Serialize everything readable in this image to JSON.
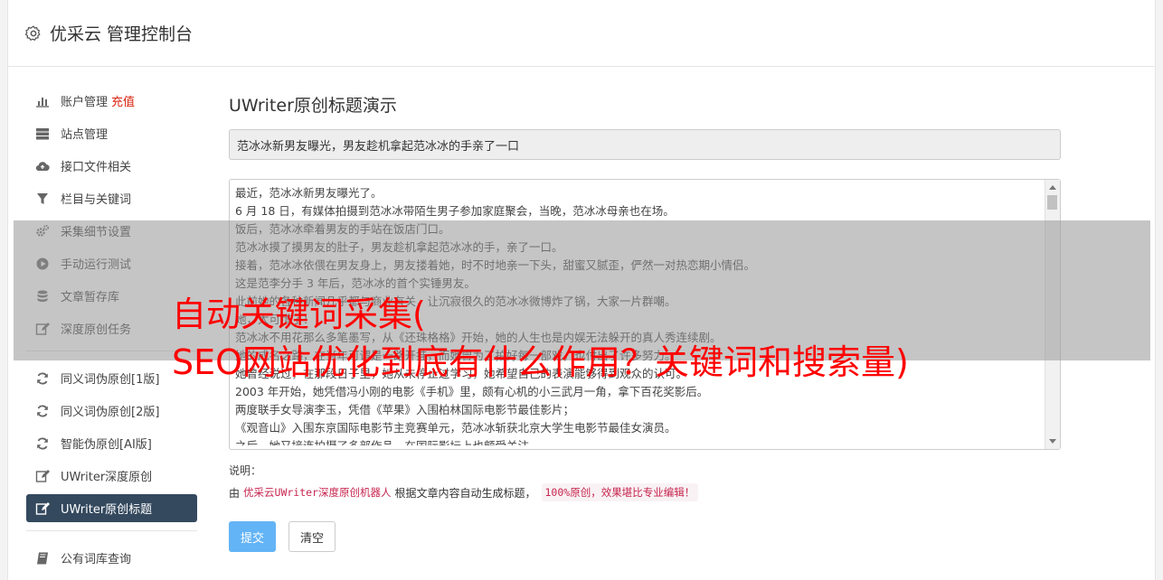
{
  "header": {
    "title": "优采云 管理控制台",
    "icon": "gear-icon"
  },
  "sidebar": {
    "groups": [
      [
        {
          "label": "账户管理",
          "badge": "充值",
          "icon": "bar-chart-icon",
          "active": false
        },
        {
          "label": "站点管理",
          "icon": "server-icon",
          "active": false
        },
        {
          "label": "接口文件相关",
          "icon": "cloud-upload-icon",
          "active": false
        },
        {
          "label": "栏目与关键词",
          "icon": "filter-icon",
          "active": false
        },
        {
          "label": "采集细节设置",
          "icon": "cogs-icon",
          "active": false
        },
        {
          "label": "手动运行测试",
          "icon": "play-circle-icon",
          "active": false
        },
        {
          "label": "文章暂存库",
          "icon": "database-icon",
          "active": false
        },
        {
          "label": "深度原创任务",
          "icon": "edit-icon",
          "active": false
        }
      ],
      [
        {
          "label": "同义词伪原创[1版]",
          "icon": "refresh-icon",
          "active": false
        },
        {
          "label": "同义词伪原创[2版]",
          "icon": "refresh-icon",
          "active": false
        },
        {
          "label": "智能伪原创[AI版]",
          "icon": "refresh-icon",
          "active": false
        },
        {
          "label": "UWriter深度原创",
          "icon": "edit-icon",
          "active": false
        },
        {
          "label": "UWriter原创标题",
          "icon": "edit-icon",
          "active": true
        }
      ],
      [
        {
          "label": "公有词库查询",
          "icon": "book-icon",
          "active": false
        }
      ]
    ]
  },
  "main": {
    "heading": "UWriter原创标题演示",
    "title_value": "范冰冰新男友曝光，男友趁机拿起范冰冰的手亲了一口",
    "content_lines": [
      "最近，范冰冰新男友曝光了。",
      "6 月 18 日，有媒体拍摄到范冰冰带陌生男子参加家庭聚会，当晚，范冰冰母亲也在场。",
      "饭后，范冰冰牵着男友的手站在饭店门口。",
      "范冰冰摸了摸男友的肚子，男友趁机拿起范冰冰的手，亲了一口。",
      "接着，范冰冰依偎在男友身上，男友搂着她，时不时地亲一下头，甜蜜又腻歪，俨然一对热恋期小情侣。",
      "这是范李分手 3 年后，范冰冰的首个实锤男友。",
      "此前她的各种新闻几乎都与商业有关，让沉寂很久的范冰冰微博炸了锅，大家一片群嘲。",
      "她，太可惜了！",
      "范冰冰不用花那么多笔墨写，从《还珠格格》开始，她的人生也是内娱无法躲开的真人秀连续剧。",
      "她的成名之路，在当年可谓是一路开挂，而她曾为了拍好每一部戏，也付出了许多努力。",
      "她曾经说过，在那段日子里，她从未停止过学习，她希望自己的表演能够得到观众的认可。",
      "2003 年开始，她凭借冯小刚的电影《手机》里，颇有心机的小三武月一角，拿下百花奖影后。",
      "两度联手女导演李玉，凭借《苹果》入围柏林国际电影节最佳影片；",
      "《观音山》入围东京国际电影节主竞赛单元，范冰冰斩获北京大学生电影节最佳女演员。",
      "之后，她又接连拍摄了多部作品，在国际影坛上也颇受关注。"
    ],
    "note_label": "说明：",
    "note_prefix": "由",
    "note_code": "优采云UWriter深度原创机器人",
    "note_middle": "根据文章内容自动生成标题，",
    "note_highlight": "100%原创，效果堪比专业编辑！",
    "submit_label": "提交",
    "clear_label": "清空"
  },
  "overlay": {
    "line1": "自动关键词采集(",
    "line2": "SEO网站优化到底有什么作用？关键词和搜索量)"
  }
}
